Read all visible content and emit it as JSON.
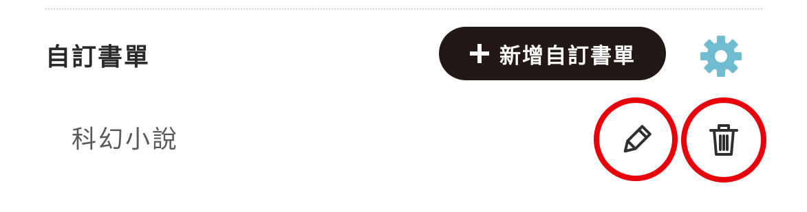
{
  "section": {
    "title": "自訂書單",
    "add_button_label": "新增自訂書單"
  },
  "lists": [
    {
      "name": "科幻小說"
    }
  ],
  "colors": {
    "button_bg": "#231815",
    "gear": "#6fbcd0",
    "highlight_ring": "#e8000b",
    "title_text": "#2a2a2a",
    "item_text": "#5a5a5a"
  },
  "icons": {
    "add": "plus-icon",
    "settings": "gear-icon",
    "edit": "pencil-icon",
    "delete": "trash-icon"
  }
}
